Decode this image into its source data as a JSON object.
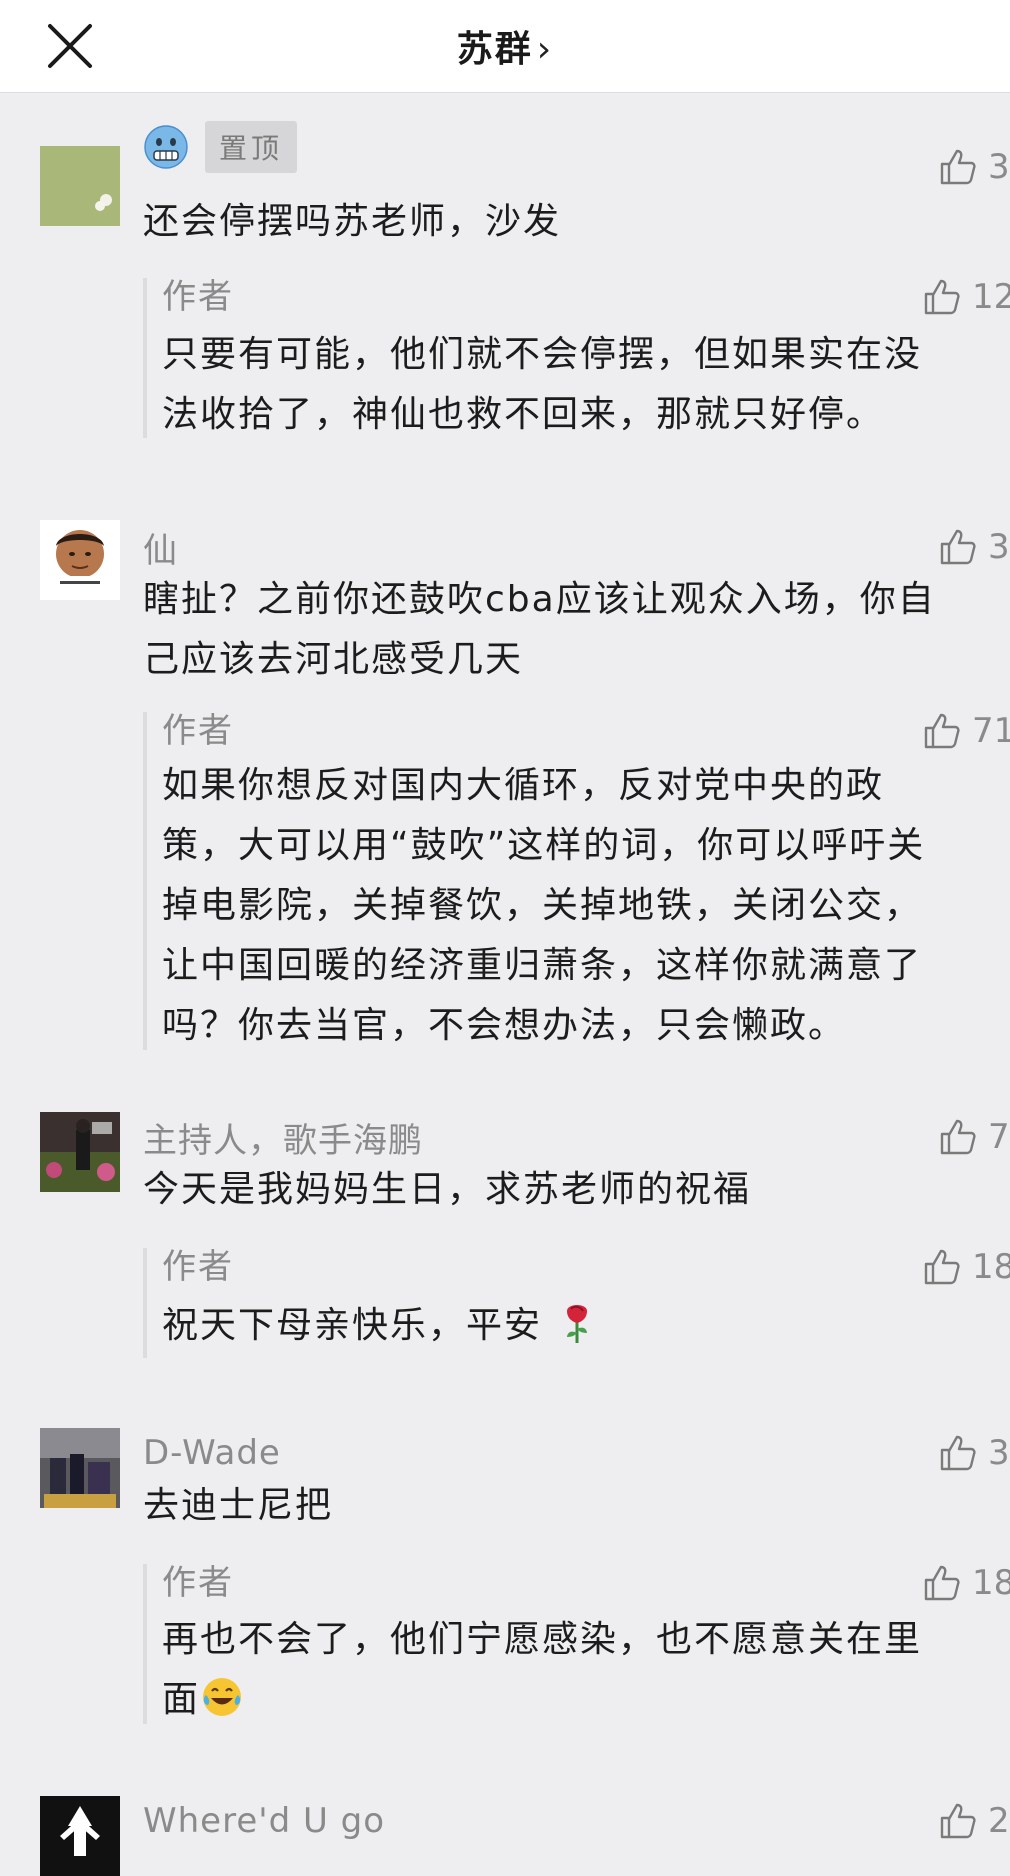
{
  "header": {
    "title": "苏群",
    "chevron": "›",
    "close_icon": "close-icon"
  },
  "reply_author_label": "作者",
  "comments": [
    {
      "user": "",
      "user_emoji": "cold-face-emoji",
      "pinned_label": "置顶",
      "text_lines": [
        "还会停摆吗苏老师，沙发"
      ],
      "likes": "3",
      "reply": {
        "likes": "12",
        "text_lines": [
          "只要有可能，他们就不会停摆，但如果实在没",
          "法收拾了，神仙也救不回来，那就只好停。"
        ]
      }
    },
    {
      "user": "仙",
      "text_lines": [
        "瞎扯？之前你还鼓吹cba应该让观众入场，你自",
        "己应该去河北感受几天"
      ],
      "likes": "3",
      "reply": {
        "likes": "71",
        "text_lines": [
          "如果你想反对国内大循环，反对党中央的政",
          "策，大可以用“鼓吹”这样的词，你可以呼吁关",
          "掉电影院，关掉餐饮，关掉地铁，关闭公交，",
          "让中国回暖的经济重归萧条，这样你就满意了",
          "吗？你去当官，不会想办法，只会懒政。"
        ]
      }
    },
    {
      "user": "主持人，歌手海鹏",
      "text_lines": [
        "今天是我妈妈生日，求苏老师的祝福"
      ],
      "likes": "7",
      "reply": {
        "likes": "18",
        "text_lines": [
          "祝天下母亲快乐，平安"
        ],
        "emoji": "rose-emoji"
      }
    },
    {
      "user": "D-Wade",
      "text_lines": [
        "去迪士尼把"
      ],
      "likes": "3",
      "reply": {
        "likes": "18",
        "text_lines": [
          "再也不会了，他们宁愿感染，也不愿意关在里",
          "面"
        ],
        "emoji": "crying-laughing-emoji"
      }
    },
    {
      "user": "Where'd U go",
      "text_lines": [],
      "likes": "2"
    }
  ],
  "colors": {
    "background": "#eeeef0",
    "header_bg": "#ffffff",
    "meta_text": "#8a8a8a",
    "body_text": "#1c1c1c",
    "quote_bar": "#dcdcde"
  }
}
